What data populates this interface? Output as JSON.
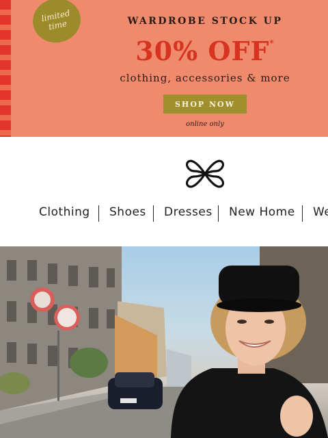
{
  "banner": {
    "badge_line1": "limited",
    "badge_line2": "time",
    "headline": "WARDROBE STOCK UP",
    "offer": "30% OFF",
    "offer_mark": "*",
    "subtitle": "clothing, accessories & more",
    "cta_label": "SHOP NOW",
    "note": "online only",
    "colors": {
      "background": "#f08a6c",
      "accent": "#d63320",
      "button": "#a08f2d"
    }
  },
  "nav": {
    "items": [
      "Clothing",
      "Shoes",
      "Dresses",
      "New Home",
      "We"
    ]
  },
  "hero": {
    "alt_icon": "photo-woman-street"
  }
}
